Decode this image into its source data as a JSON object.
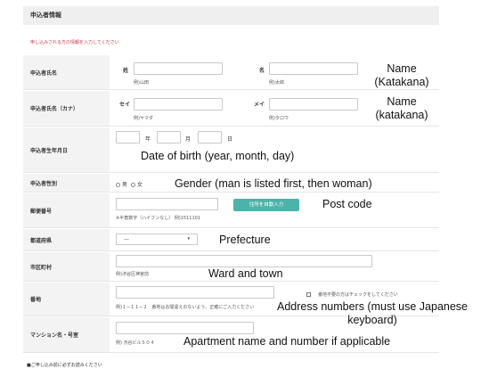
{
  "header": {
    "title": "申込者情報"
  },
  "instruction": "申し込みされる方の情報を入力してください",
  "name_row": {
    "label": "申込者氏名",
    "sei_label": "姓",
    "mei_label": "名",
    "sei_example": "例)山田",
    "mei_example": "例)太郎"
  },
  "kana_row": {
    "label": "申込者氏名（カナ）",
    "sei_label": "セイ",
    "mei_label": "メイ",
    "sei_example": "例)ヤマダ",
    "mei_example": "例)タロウ"
  },
  "birth_row": {
    "label": "申込者生年月日",
    "year": "年",
    "month": "月",
    "day": "日"
  },
  "gender_row": {
    "label": "申込者性別",
    "male": "男",
    "female": "女"
  },
  "postcode_row": {
    "label": "郵便番号",
    "note": "※半角数字（ハイフンなし） 例)1511101",
    "auto_button": "住所を自動入力"
  },
  "prefecture_row": {
    "label": "都道府県",
    "selected": "—"
  },
  "city_row": {
    "label": "市区町村",
    "example": "例)渋谷区神宮前"
  },
  "address_row": {
    "label": "番地",
    "checkbox_label": "番地不要の方はチェックをしてください",
    "example": "例)１−１１−２　番地はお間違えのないよう、正確にご入力ください"
  },
  "building_row": {
    "label": "マンション名・号室",
    "example": "例) 渋谷ビル５０４"
  },
  "footer_note": "■ご申し込み前に必ずお読みください",
  "annotations": {
    "name": "Name\n(Katakana)",
    "name_kana": "Name\n(katakana)",
    "dob": "Date of birth (year, month, day)",
    "gender": "Gender (man is listed first, then woman)",
    "postcode": "Post code",
    "prefecture": "Prefecture",
    "ward": "Ward and town",
    "address": "Address numbers (must use Japanese\nkeyboard)",
    "apartment": "Apartment name and number if applicable"
  }
}
